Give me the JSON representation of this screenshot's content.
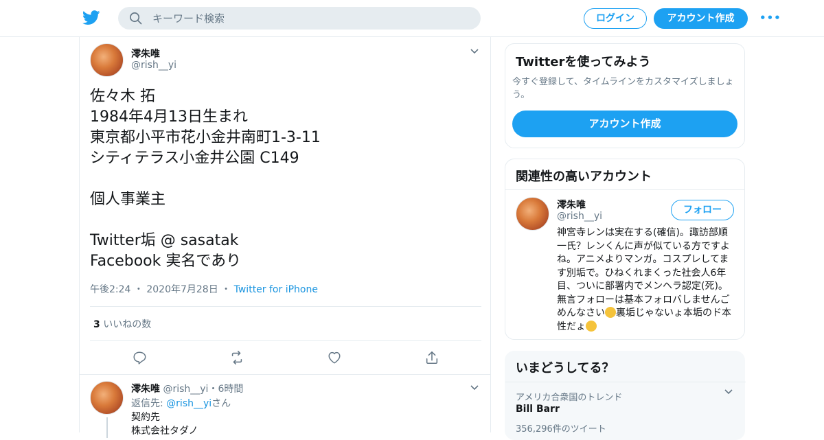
{
  "header": {
    "search_placeholder": "キーワード検索",
    "login_label": "ログイン",
    "signup_label": "アカウント作成",
    "more_label": "•••"
  },
  "tweet": {
    "name": "澪朱唯",
    "handle": "@rish__yi",
    "text": "佐々木 拓\n1984年4月13日生まれ\n東京都小平市花小金井南町1-3-11\nシティテラス小金井公園 C149\n\n個人事業主\n\nTwitter垢 @ sasatak\nFacebook 実名であり",
    "time": "午後2:24",
    "date": "2020年7月28日",
    "source": "Twitter for iPhone",
    "likes_count": "3",
    "likes_label": "いいねの数"
  },
  "reply": {
    "name": "澪朱唯",
    "handle": "@rish__yi",
    "age": "6時間",
    "reply_to_prefix": "返信先: ",
    "reply_to_link": "@rish__yi",
    "reply_to_suffix": "さん",
    "text": "契約先\n株式会社タダノ"
  },
  "sidebar": {
    "signup_card": {
      "title": "Twitterを使ってみよう",
      "description": "今すぐ登録して、タイムラインをカスタマイズしましょう。",
      "button": "アカウント作成"
    },
    "related_card": {
      "title": "関連性の高いアカウント",
      "name": "澪朱唯",
      "handle": "@rish__yi",
      "follow": "フォロー",
      "bio_part1": "神宮寺レンは実在する(確信)。諏訪部順一氏？レンくんに声が似ている方ですよね。アニメよりマンガ。コスプレしてます別垢で。ひねくれまくった社会人6年目、ついに部署内でメンヘラ認定(死)。無言フォローは基本フォロバしませんごめんなさい",
      "bio_part2": "裏垢じゃないょ本垢のド本性だょ"
    },
    "trends_card": {
      "title": "いまどうしてる？",
      "location": "アメリカ合衆国のトレンド",
      "trend_name": "Bill Barr",
      "trend_count": "356,296件のツイート"
    }
  },
  "colors": {
    "accent": "#1da1f2",
    "link": "#1b95e0",
    "muted": "#657786"
  }
}
